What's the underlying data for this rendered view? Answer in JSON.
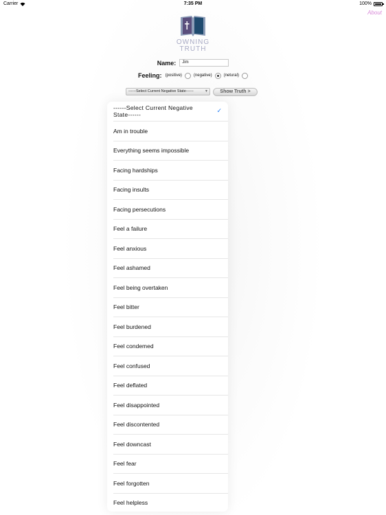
{
  "status_bar": {
    "carrier": "Carrier",
    "time": "7:35 PM",
    "battery": "100%"
  },
  "about_label": "About",
  "logo_text": "OWNING TRUTH",
  "form": {
    "name_label": "Name:",
    "name_value": "Jim",
    "feeling_label": "Feeling:",
    "options": [
      {
        "label": "(positive)",
        "checked": false
      },
      {
        "label": "(negative)",
        "checked": true
      },
      {
        "label": "(netural)",
        "checked": false
      }
    ],
    "select_value": "------Select Current Negative State------",
    "show_button": "Show Truth >"
  },
  "dropdown": {
    "selected": "------Select Current Negative State------",
    "items": [
      "------Select Current Negative State------",
      "Am in trouble",
      "Everything seems impossible",
      "Facing hardships",
      "Facing insults",
      "Facing persecutions",
      "Feel a failure",
      "Feel anxious",
      "Feel ashamed",
      "Feel being overtaken",
      "Feel bitter",
      "Feel burdened",
      "Feel condemed",
      "Feel confused",
      "Feel deflated",
      "Feel disappointed",
      "Feel discontented",
      "Feel downcast",
      "Feel fear",
      "Feel forgotten",
      "Feel helpless"
    ]
  },
  "colors": {
    "accent_check": "#1f7bf5",
    "about_link": "#d88ad8",
    "logo_text": "#a8aac4"
  }
}
